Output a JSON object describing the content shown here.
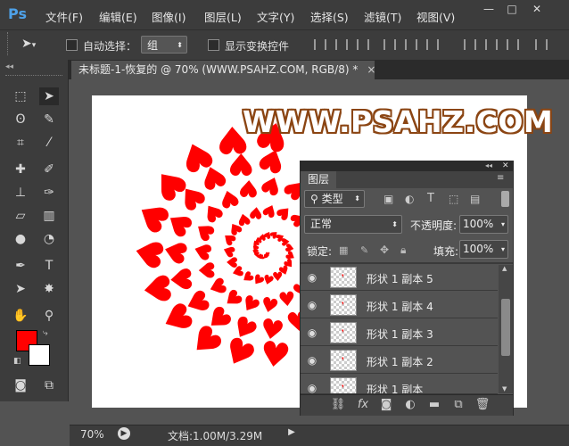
{
  "app": {
    "logo": "Ps"
  },
  "menu": [
    "文件(F)",
    "编辑(E)",
    "图像(I)",
    "图层(L)",
    "文字(Y)",
    "选择(S)",
    "滤镜(T)",
    "视图(V)"
  ],
  "window_controls": {
    "minimize": "—",
    "maximize": "□",
    "close": "✕"
  },
  "options": {
    "auto_select_label": "自动选择：",
    "auto_select_value": "组",
    "show_transform_label": "显示变换控件"
  },
  "document": {
    "tab_title": "未标题-1-恢复的 @ 70% (WWW.PSAHZ.COM, RGB/8) *",
    "tab_close": "×",
    "watermark_text": "WWW.PSAHZ.COM"
  },
  "status": {
    "zoom": "70%",
    "doc_info": "文档:1.00M/3.29M"
  },
  "colors": {
    "foreground": "#ff0000",
    "background": "#ffffff",
    "heart": "#ff0000",
    "watermark_outline": "#8b4513"
  },
  "layers_panel": {
    "title": "图层",
    "filter_label": "类型",
    "blend_mode": "正常",
    "opacity_label": "不透明度:",
    "opacity_value": "100%",
    "lock_label": "锁定:",
    "fill_label": "填充:",
    "fill_value": "100%",
    "layers": [
      {
        "name": "形状 1 副本 5"
      },
      {
        "name": "形状 1 副本 4"
      },
      {
        "name": "形状 1 副本 3"
      },
      {
        "name": "形状 1 副本 2"
      },
      {
        "name": "形状 1 副本"
      }
    ]
  }
}
